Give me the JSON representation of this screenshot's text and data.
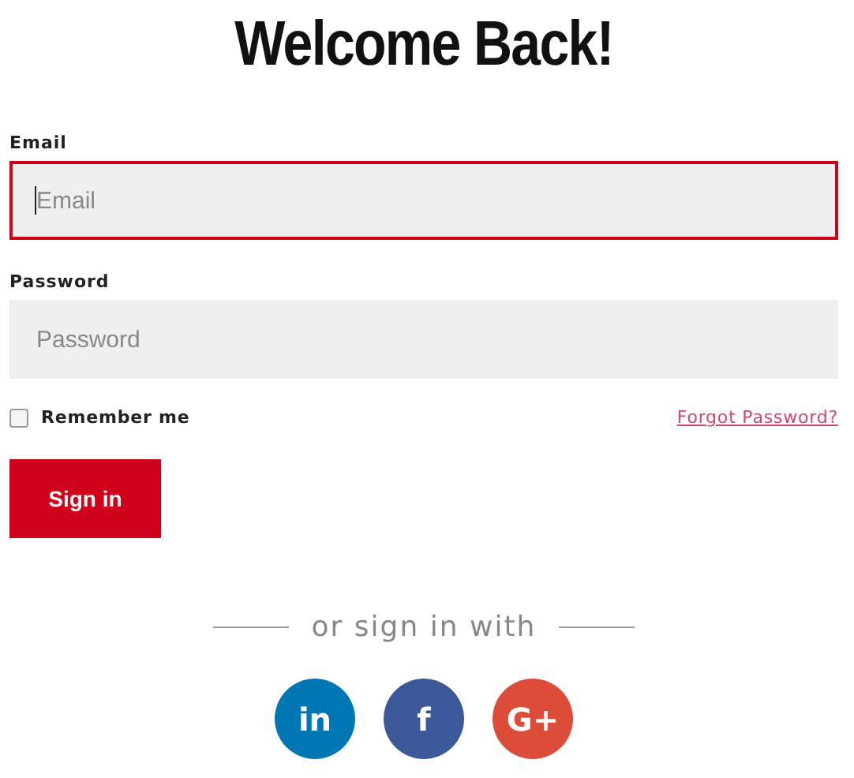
{
  "title": "Welcome Back!",
  "fields": [
    {
      "label": "Email",
      "placeholder": "Email",
      "focused": true
    },
    {
      "label": "Password",
      "placeholder": "Password",
      "focused": false
    }
  ],
  "remember": {
    "label": "Remember me",
    "checked": false
  },
  "forgot_link": "Forgot Password?",
  "submit": "Sign in",
  "divider": "or sign in with",
  "social": [
    {
      "glyph": "in",
      "color": "#0077b5"
    },
    {
      "glyph": "f",
      "color": "#3b5998"
    },
    {
      "glyph": "G+",
      "color": "#dd4b39"
    }
  ]
}
